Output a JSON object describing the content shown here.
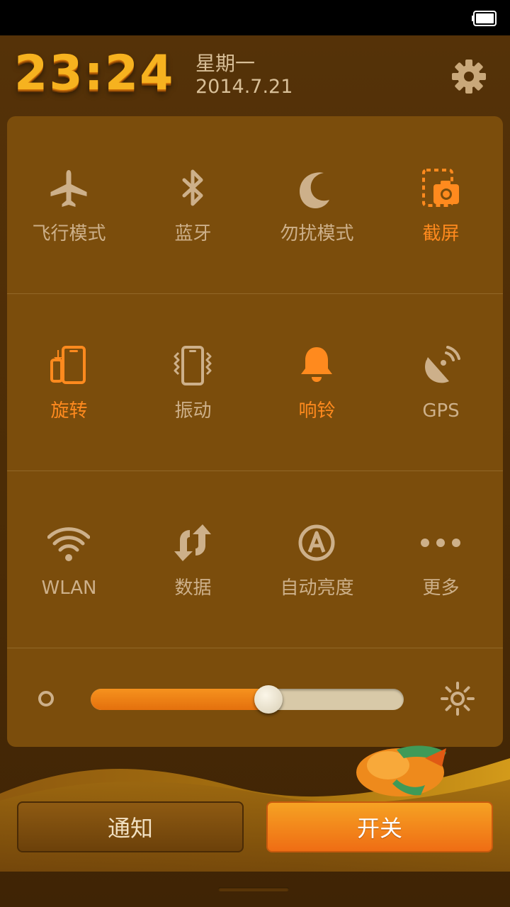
{
  "status_bar": {
    "battery_icon": "battery-full-icon"
  },
  "header": {
    "time": "23:24",
    "weekday": "星期一",
    "date": "2014.7.21",
    "settings_icon": "gear-icon"
  },
  "toggles": [
    {
      "label": "飞行模式",
      "icon": "airplane-icon",
      "active": false
    },
    {
      "label": "蓝牙",
      "icon": "bluetooth-icon",
      "active": false
    },
    {
      "label": "勿扰模式",
      "icon": "moon-icon",
      "active": false
    },
    {
      "label": "截屏",
      "icon": "screenshot-icon",
      "active": true
    },
    {
      "label": "旋转",
      "icon": "rotate-icon",
      "active": true
    },
    {
      "label": "振动",
      "icon": "vibrate-icon",
      "active": false
    },
    {
      "label": "响铃",
      "icon": "bell-icon",
      "active": true
    },
    {
      "label": "GPS",
      "icon": "gps-icon",
      "active": false
    },
    {
      "label": "WLAN",
      "icon": "wifi-icon",
      "active": false
    },
    {
      "label": "数据",
      "icon": "data-arrows-icon",
      "active": false
    },
    {
      "label": "自动亮度",
      "icon": "auto-brightness-icon",
      "active": false
    },
    {
      "label": "更多",
      "icon": "more-dots-icon",
      "active": false
    }
  ],
  "brightness": {
    "level": 0.545,
    "min_icon": "brightness-low-icon",
    "max_icon": "brightness-high-icon"
  },
  "tabs": {
    "notify_label": "通知",
    "toggle_label": "开关"
  },
  "colors": {
    "accent": "#ff8a1e",
    "inactive": "#cdb08a",
    "panel": "#7b4d0c"
  }
}
